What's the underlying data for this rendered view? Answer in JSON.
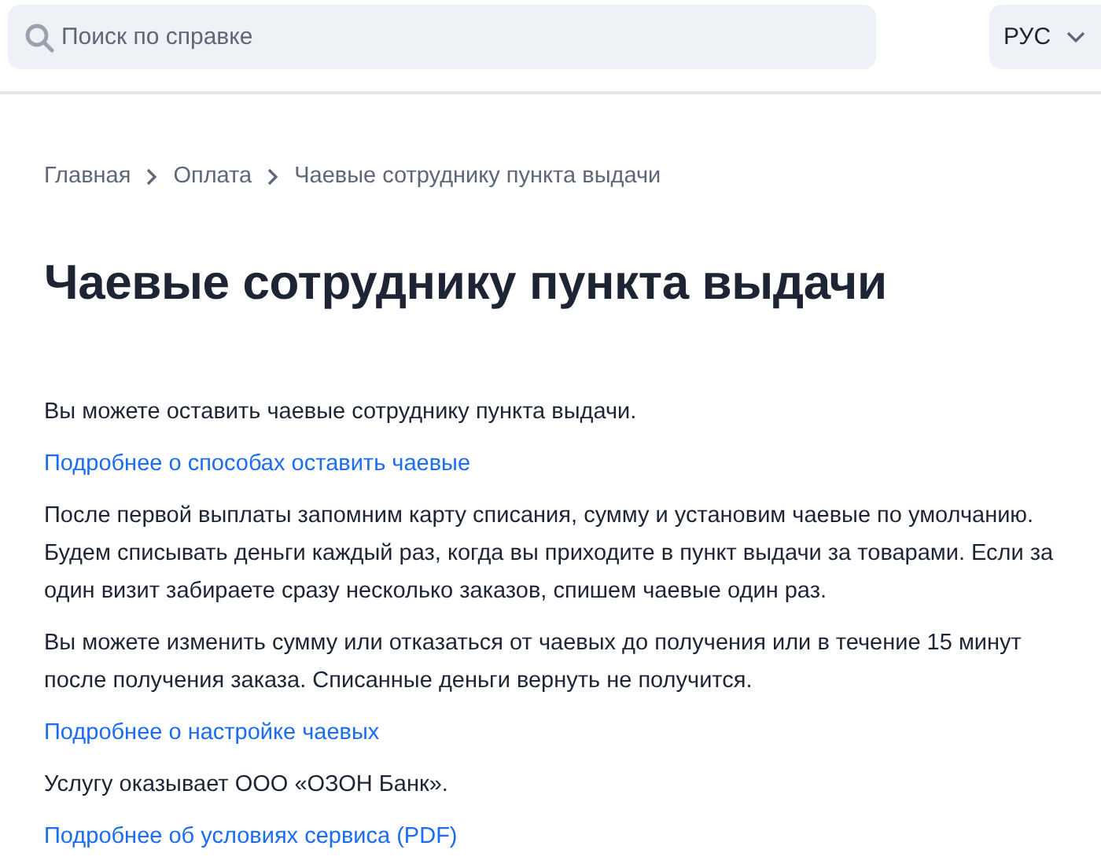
{
  "search": {
    "placeholder": "Поиск по справке"
  },
  "language": {
    "label": "РУС"
  },
  "breadcrumbs": [
    "Главная",
    "Оплата",
    "Чаевые сотруднику пункта выдачи"
  ],
  "title": "Чаевые сотруднику пункта выдачи",
  "content": [
    {
      "kind": "paragraph",
      "text": "Вы можете оставить чаевые сотруднику пункта выдачи."
    },
    {
      "kind": "link",
      "text": "Подробнее о способах оставить чаевые"
    },
    {
      "kind": "paragraph",
      "text": "После первой выплаты запомним карту списания, сумму и установим чаевые по умолчанию. Будем списывать деньги каждый раз, когда вы приходите в пункт выдачи за товарами. Если за один визит забираете сразу несколько заказов, спишем чаевые один раз."
    },
    {
      "kind": "paragraph",
      "text": "Вы можете изменить сумму или отказаться от чаевых до получения или в течение 15 минут после получения заказа. Списанные деньги вернуть не получится."
    },
    {
      "kind": "link",
      "text": "Подробнее о настройке чаевых"
    },
    {
      "kind": "paragraph",
      "text": "Услугу оказывает ООО «ОЗОН Банк»."
    },
    {
      "kind": "link",
      "text": "Подробнее об условиях сервиса (PDF)"
    }
  ]
}
